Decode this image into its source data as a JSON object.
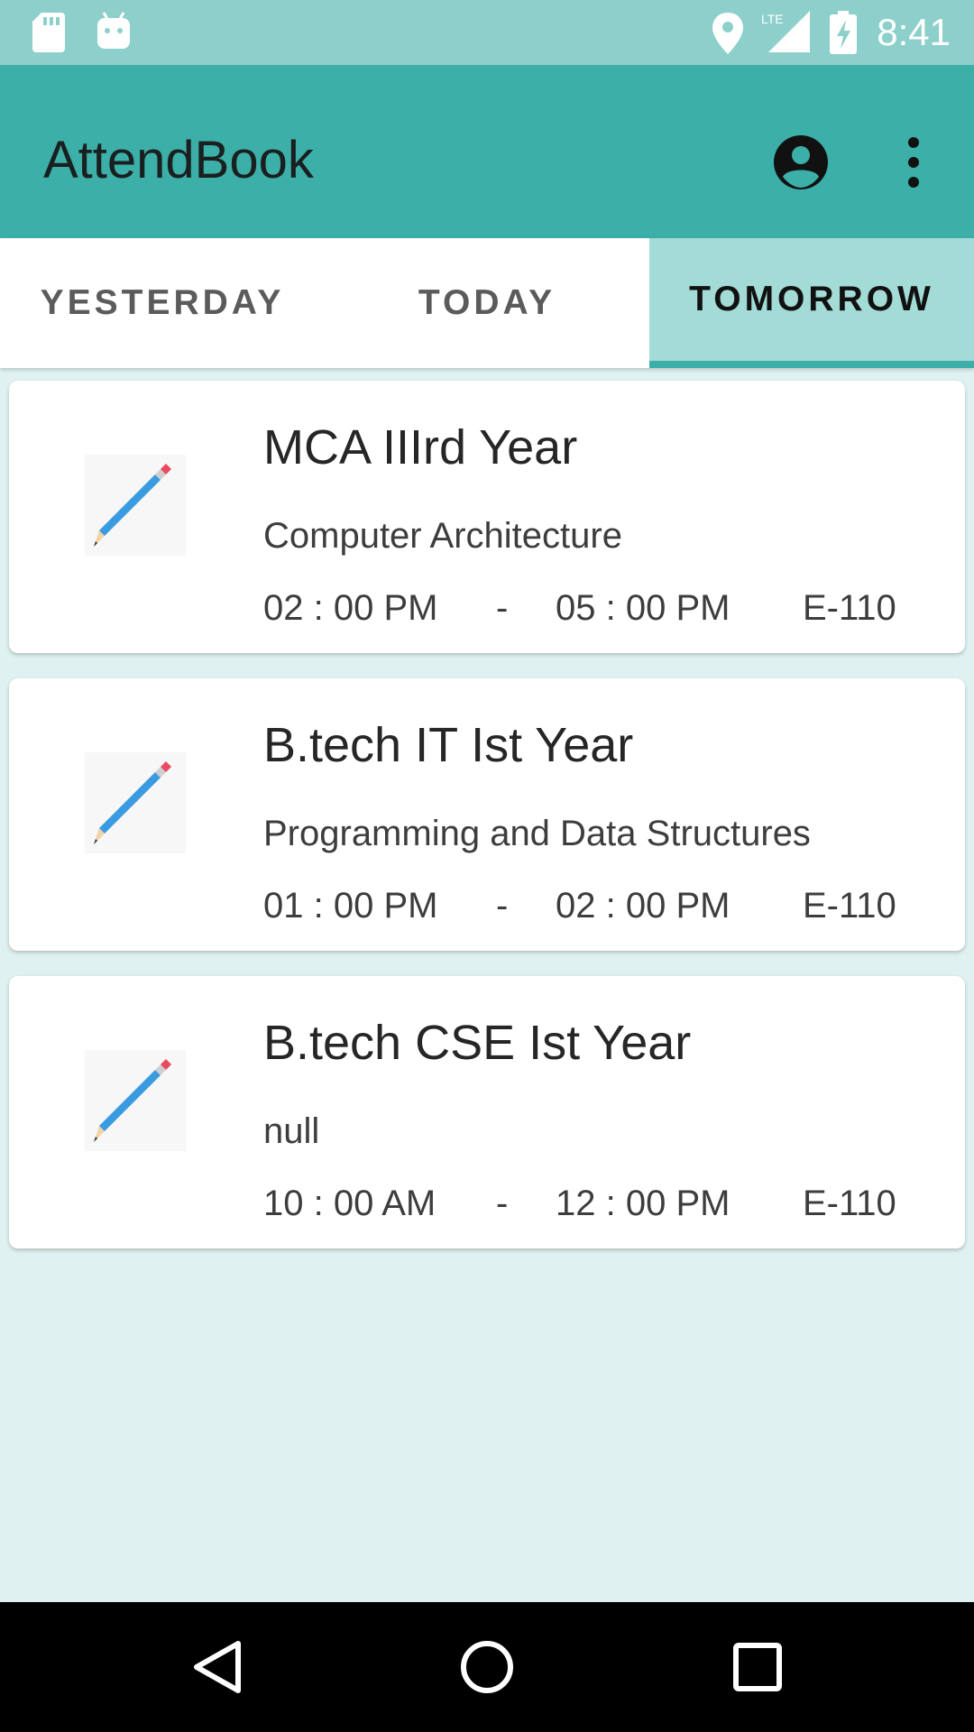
{
  "status_bar": {
    "time": "8:41",
    "left_icons": [
      "sd-card-icon",
      "android-icon"
    ],
    "right_icons": [
      "location-icon",
      "lte-signal-icon",
      "battery-charging-icon"
    ],
    "network_label": "LTE"
  },
  "app_bar": {
    "title": "AttendBook",
    "actions": [
      "account-circle-icon",
      "more-vert-icon"
    ]
  },
  "tabs": [
    {
      "label": "YESTERDAY",
      "selected": false
    },
    {
      "label": "TODAY",
      "selected": false
    },
    {
      "label": "TOMORROW",
      "selected": true
    }
  ],
  "classes": [
    {
      "title": "MCA IIIrd Year",
      "subject": "Computer Architecture",
      "start": "02 : 00 PM",
      "separator": "-",
      "end": "05 : 00 PM",
      "room": "E-110",
      "icon": "pencil-icon"
    },
    {
      "title": "B.tech IT Ist Year",
      "subject": "Programming and Data Structures",
      "start": "01 : 00 PM",
      "separator": "-",
      "end": "02 : 00 PM",
      "room": "E-110",
      "icon": "pencil-icon"
    },
    {
      "title": "B.tech CSE Ist Year",
      "subject": "null",
      "start": "10 : 00 AM",
      "separator": "-",
      "end": "12 : 00 PM",
      "room": "E-110",
      "icon": "pencil-icon"
    }
  ],
  "nav_bar": {
    "buttons": [
      "back-icon",
      "home-icon",
      "recents-icon"
    ]
  },
  "colors": {
    "status_bar": "#8dd0cb",
    "app_bar": "#3bafa8",
    "selected_tab": "#a3dbd6",
    "background": "#dff1f0",
    "card": "#ffffff",
    "pencil_body": "#3a9be0",
    "pencil_eraser": "#e84a5f"
  }
}
